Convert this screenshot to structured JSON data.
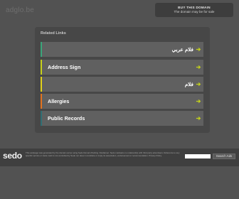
{
  "header": {
    "domain": "adglo.be"
  },
  "buy_box": {
    "line1": "BUY THIS DOMAIN",
    "line2": "The domain may be for sale"
  },
  "related": {
    "title": "Related Links",
    "links": [
      {
        "label": "فلام عربي",
        "accent": "#3aa57a",
        "arrow": "➔",
        "dir": "rtl"
      },
      {
        "label": "Address Sign",
        "accent": "#c8d11b",
        "arrow": "➔",
        "dir": "ltr"
      },
      {
        "label": "فلام",
        "accent": "#e2d21b",
        "arrow": "➔",
        "dir": "rtl"
      },
      {
        "label": "Allergies",
        "accent": "#e3731e",
        "arrow": "➔",
        "dir": "ltr"
      },
      {
        "label": "Public Records",
        "accent": "#2f6f74",
        "arrow": "➔",
        "dir": "ltr"
      }
    ]
  },
  "footer": {
    "logo": "sedo",
    "disclaimer": "This webpage was generated by the domain owner using Sedo Domain Parking. Disclaimer: Sedo maintains no relationship with third party advertisers. Reference to any specific service or trade mark is not controlled by Sedo nor does it constitute or imply its association, endorsement or recommendation. Privacy Policy",
    "search_button": "Search Ads"
  }
}
